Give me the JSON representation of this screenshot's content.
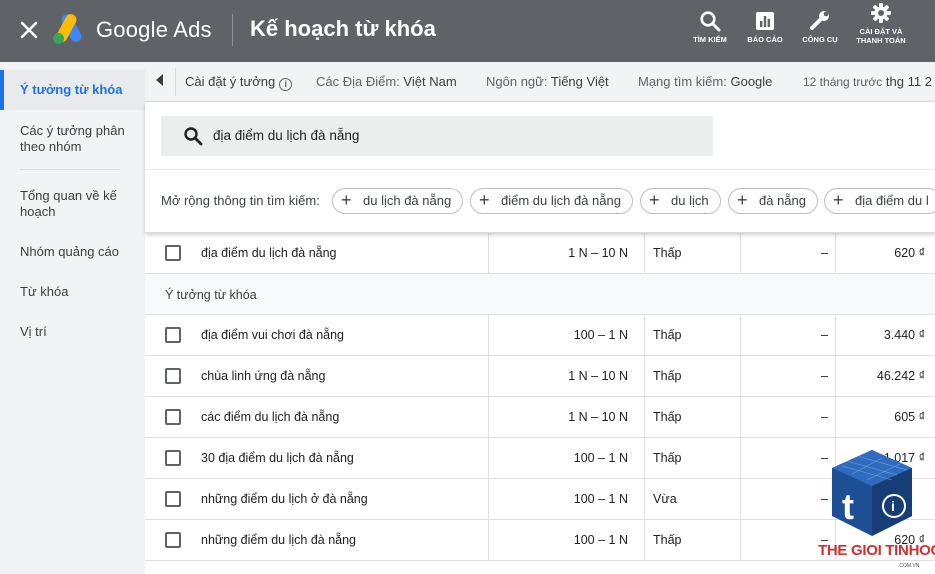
{
  "header": {
    "brand": "Google Ads",
    "title": "Kế hoạch từ khóa",
    "tools": [
      {
        "label": "TÌM KIẾM",
        "icon": "search-icon"
      },
      {
        "label": "BÁO CÁO",
        "icon": "reports-icon"
      },
      {
        "label": "CÔNG CỤ",
        "icon": "wrench-icon"
      },
      {
        "label": "CÀI ĐẶT VÀ THANH TOÁN",
        "icon": "gear-icon"
      }
    ]
  },
  "sidebar": {
    "items": [
      {
        "label": "Ý tưởng từ khóa",
        "active": true
      },
      {
        "label": "Các ý tưởng phân theo nhóm"
      },
      {
        "label": "Tổng quan về kế hoạch"
      },
      {
        "label": "Nhóm quảng cáo"
      },
      {
        "label": "Từ khóa"
      },
      {
        "label": "Vị trí"
      }
    ]
  },
  "settings_bar": {
    "settings_label": "Cài đặt ý tưởng",
    "location_label": "Các Địa Điểm:",
    "location_value": "Việt Nam",
    "language_label": "Ngôn ngữ:",
    "language_value": "Tiếng Việt",
    "network_label": "Mạng tìm kiếm:",
    "network_value": "Google",
    "period_label": "12 tháng trước",
    "period_value": "thg 11 2"
  },
  "search": {
    "value": "địa điểm du lịch đà nẵng"
  },
  "expand": {
    "label": "Mở rộng thông tin tìm kiếm:",
    "chips": [
      "du lịch đà nẵng",
      "điểm du lịch đà nẵng",
      "du lịch",
      "đà nẵng",
      "địa điểm du l"
    ]
  },
  "table": {
    "searched_rows": [
      {
        "keyword": "địa điểm du lịch đà nẵng",
        "volume": "1 N – 10 N",
        "competition": "Thấp",
        "share": "–",
        "bid": "620 ₫"
      }
    ],
    "group_label": "Ý tưởng từ khóa",
    "idea_rows": [
      {
        "keyword": "địa điểm vui chơi đà nẵng",
        "volume": "100 – 1 N",
        "competition": "Thấp",
        "share": "–",
        "bid": "3.440 ₫"
      },
      {
        "keyword": "chùa linh ứng đà nẵng",
        "volume": "1 N – 10 N",
        "competition": "Thấp",
        "share": "–",
        "bid": "46.242 ₫"
      },
      {
        "keyword": "các điểm du lịch đà nẵng",
        "volume": "1 N – 10 N",
        "competition": "Thấp",
        "share": "–",
        "bid": "605 ₫"
      },
      {
        "keyword": "30 địa điểm du lịch đà nẵng",
        "volume": "100 – 1 N",
        "competition": "Thấp",
        "share": "–",
        "bid": "1.017 ₫"
      },
      {
        "keyword": "những điểm du lịch ở đà nẵng",
        "volume": "100 – 1 N",
        "competition": "Vừa",
        "share": "–",
        "bid": ""
      },
      {
        "keyword": "những điểm du lịch đà nẵng",
        "volume": "100 – 1 N",
        "competition": "Thấp",
        "share": "–",
        "bid": "620 ₫"
      }
    ]
  },
  "watermark": {
    "text": "THE GIOI TINHOC",
    "sub": ".COM.VN"
  }
}
